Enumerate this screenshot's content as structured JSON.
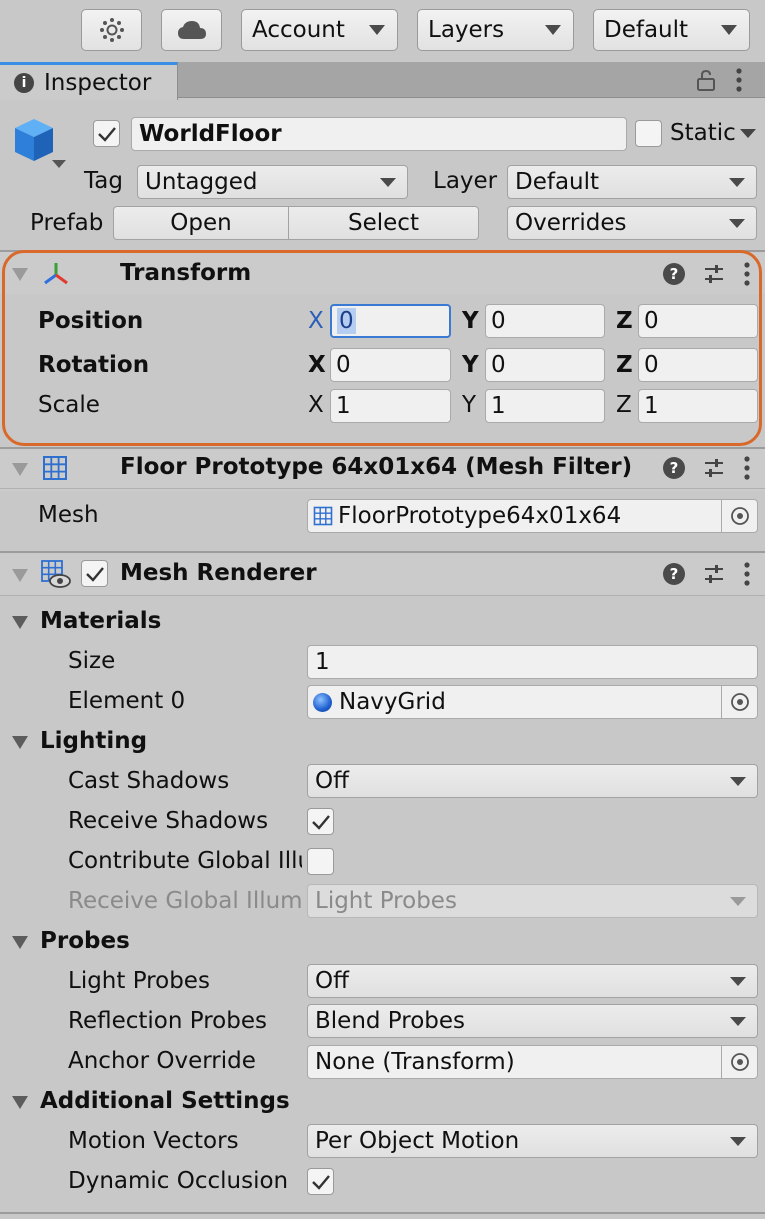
{
  "toolbar": {
    "account_label": "Account",
    "layers_label": "Layers",
    "layout_label": "Default"
  },
  "tab": {
    "title": "Inspector"
  },
  "object": {
    "name": "WorldFloor",
    "active": true,
    "static_label": "Static",
    "static_checked": false,
    "tag_label": "Tag",
    "tag_value": "Untagged",
    "layer_label": "Layer",
    "layer_value": "Default",
    "prefab_label": "Prefab",
    "prefab_open": "Open",
    "prefab_select": "Select",
    "prefab_overrides": "Overrides"
  },
  "transform": {
    "title": "Transform",
    "highlight_color": "#d9692a",
    "rows": [
      {
        "label": "Position",
        "x": "0",
        "y": "0",
        "z": "0"
      },
      {
        "label": "Rotation",
        "x": "0",
        "y": "0",
        "z": "0"
      },
      {
        "label": "Scale",
        "x": "1",
        "y": "1",
        "z": "1"
      }
    ],
    "axis_labels": {
      "x": "X",
      "y": "Y",
      "z": "Z"
    }
  },
  "mesh_filter": {
    "title": "Floor Prototype 64x01x64 (Mesh Filter)",
    "mesh_label": "Mesh",
    "mesh_value": "FloorPrototype64x01x64"
  },
  "mesh_renderer": {
    "title": "Mesh Renderer",
    "enabled": true,
    "materials": {
      "header": "Materials",
      "size_label": "Size",
      "size_value": "1",
      "element0_label": "Element 0",
      "element0_value": "NavyGrid"
    },
    "lighting": {
      "header": "Lighting",
      "cast_shadows_label": "Cast Shadows",
      "cast_shadows_value": "Off",
      "receive_shadows_label": "Receive Shadows",
      "receive_shadows_checked": true,
      "contribute_gi_label": "Contribute Global Illu",
      "contribute_gi_checked": false,
      "receive_gi_label": "Receive Global Illumi",
      "receive_gi_value": "Light Probes"
    },
    "probes": {
      "header": "Probes",
      "light_probes_label": "Light Probes",
      "light_probes_value": "Off",
      "reflection_probes_label": "Reflection Probes",
      "reflection_probes_value": "Blend Probes",
      "anchor_override_label": "Anchor Override",
      "anchor_override_value": "None (Transform)"
    },
    "additional": {
      "header": "Additional Settings",
      "motion_vectors_label": "Motion Vectors",
      "motion_vectors_value": "Per Object Motion",
      "dynamic_occlusion_label": "Dynamic Occlusion",
      "dynamic_occlusion_checked": true
    }
  }
}
